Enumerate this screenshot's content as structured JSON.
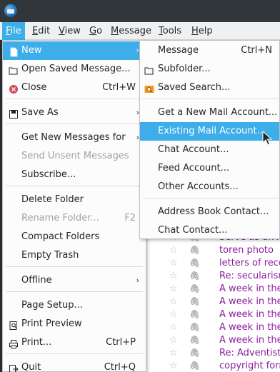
{
  "menubar": {
    "items": [
      {
        "label": "File",
        "ul": "F"
      },
      {
        "label": "Edit",
        "ul": "E"
      },
      {
        "label": "View",
        "ul": "V"
      },
      {
        "label": "Go",
        "ul": "G"
      },
      {
        "label": "Message",
        "ul": "M"
      },
      {
        "label": "Tools",
        "ul": "T"
      },
      {
        "label": "Help",
        "ul": "H"
      }
    ]
  },
  "file_menu": {
    "new": "New",
    "open_saved": "Open Saved Message...",
    "close": "Close",
    "close_sc": "Ctrl+W",
    "save_as": "Save As",
    "get_new_messages": "Get New Messages for",
    "send_unsent": "Send Unsent Messages",
    "subscribe": "Subscribe...",
    "delete_folder": "Delete Folder",
    "rename_folder": "Rename Folder...",
    "rename_sc": "F2",
    "compact_folders": "Compact Folders",
    "empty_trash": "Empty Trash",
    "offline": "Offline",
    "page_setup": "Page Setup...",
    "print_preview": "Print Preview",
    "print": "Print...",
    "print_sc": "Ctrl+P",
    "quit": "Quit",
    "quit_sc": "Ctrl+Q"
  },
  "new_submenu": {
    "message": "Message",
    "message_sc": "Ctrl+N",
    "subfolder": "Subfolder...",
    "saved_search": "Saved Search...",
    "get_new_mail": "Get a New Mail Account...",
    "existing_mail": "Existing Mail Account...",
    "chat_account": "Chat Account...",
    "feed_account": "Feed Account...",
    "other_accounts": "Other Accounts...",
    "address_book": "Address Book Contact...",
    "chat_contact": "Chat Contact..."
  },
  "message_list": {
    "subjects": [
      "Serve as an Ad",
      "toren photo",
      "letters of recom",
      "Re: secularism",
      "A week in the l",
      "A week in the l",
      "A week in the l",
      "A week in the l",
      "A week in the l",
      "Re: Adventists",
      "copyright form"
    ]
  },
  "colors": {
    "highlight": "#3daee9",
    "subject_text": "#8a1f9c"
  }
}
